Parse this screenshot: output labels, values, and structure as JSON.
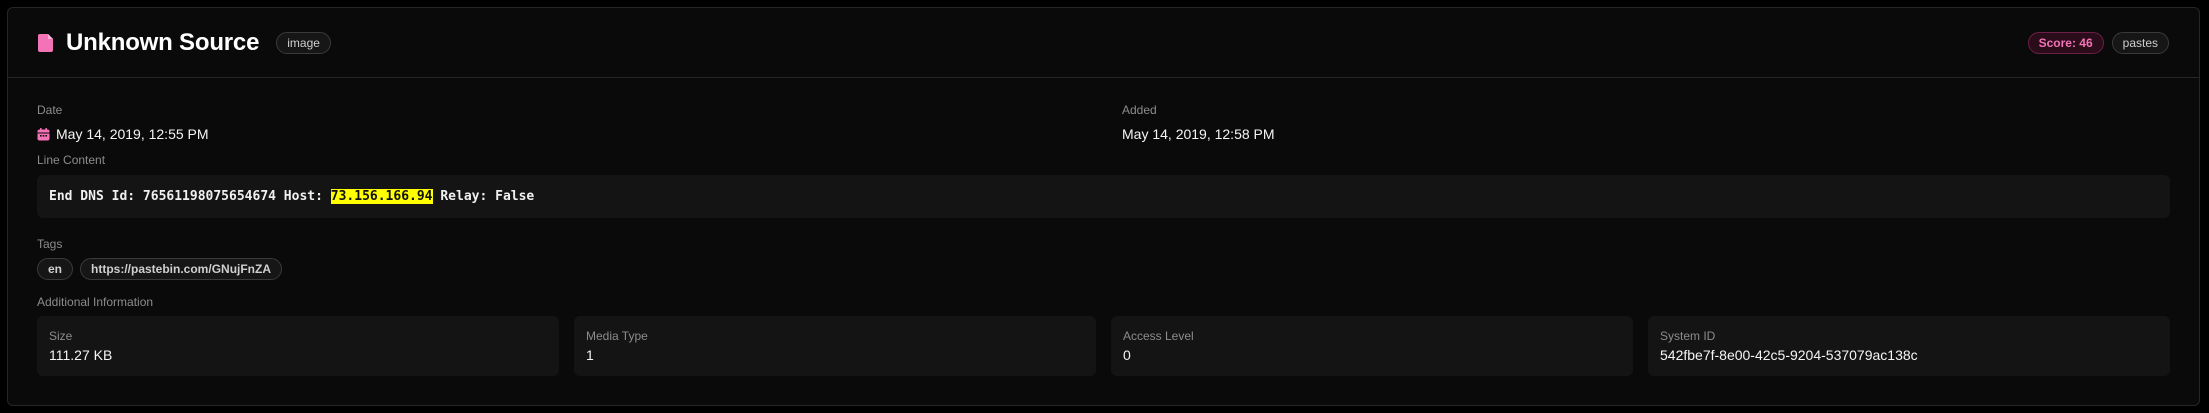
{
  "header": {
    "title": "Unknown Source",
    "type_badge": "image",
    "score_badge": "Score: 46",
    "source_badge": "pastes",
    "accent_color": "#f472b6"
  },
  "dates": {
    "date_label": "Date",
    "date_value": "May 14, 2019, 12:55 PM",
    "added_label": "Added",
    "added_value": "May 14, 2019, 12:58 PM"
  },
  "line_content": {
    "label": "Line Content",
    "prefix": "End DNS Id: 76561198075654674 Host: ",
    "highlight": "73.156.166.94",
    "suffix": " Relay: False",
    "highlight_color": "#ffff00"
  },
  "tags": {
    "label": "Tags",
    "items": [
      "en",
      "https://pastebin.com/GNujFnZA"
    ]
  },
  "additional": {
    "label": "Additional Information",
    "items": [
      {
        "label": "Size",
        "value": "111.27 KB"
      },
      {
        "label": "Media Type",
        "value": "1"
      },
      {
        "label": "Access Level",
        "value": "0"
      },
      {
        "label": "System ID",
        "value": "542fbe7f-8e00-42c5-9204-537079ac138c"
      }
    ]
  },
  "icons": {
    "title_icon": "file-icon",
    "date_icon": "calendar-icon"
  }
}
